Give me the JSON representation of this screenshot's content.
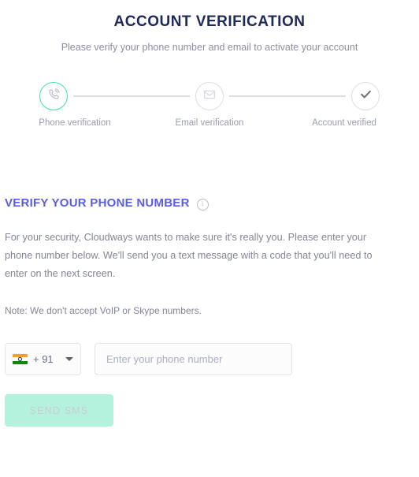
{
  "header": {
    "title": "ACCOUNT VERIFICATION",
    "subtitle": "Please verify your phone number and email to activate your account"
  },
  "stepper": {
    "steps": [
      {
        "label": "Phone verification",
        "icon": "phone-icon",
        "state": "active",
        "accent": "#3fe0ab"
      },
      {
        "label": "Email verification",
        "icon": "envelope-icon",
        "state": "inactive",
        "accent": "#dcdde4"
      },
      {
        "label": "Account verified",
        "icon": "check-icon",
        "state": "inactive",
        "accent": "#dcdde4"
      }
    ]
  },
  "section": {
    "title": "VERIFY YOUR PHONE NUMBER",
    "info_icon": "info-icon",
    "body": "For your security, Cloudways wants to make sure it's really you. Please enter your phone number below. We'll send you a text message with a code that you'll need to enter on the next screen.",
    "note": "Note: We don't accept VoIP or Skype numbers."
  },
  "form": {
    "country": {
      "flag": "india-flag-icon",
      "dial_code": "+ 91",
      "caret": "chevron-down-icon"
    },
    "phone": {
      "value": "",
      "placeholder": "Enter your phone number"
    },
    "submit_label": "SEND SMS"
  },
  "colors": {
    "title": "#20295c",
    "heading": "#5b5ce2",
    "muted": "#818698",
    "accent_green": "#3fe0ab",
    "button_bg": "#b4f2de",
    "button_text": "#c9cbd4",
    "border": "#e3e4ea"
  }
}
